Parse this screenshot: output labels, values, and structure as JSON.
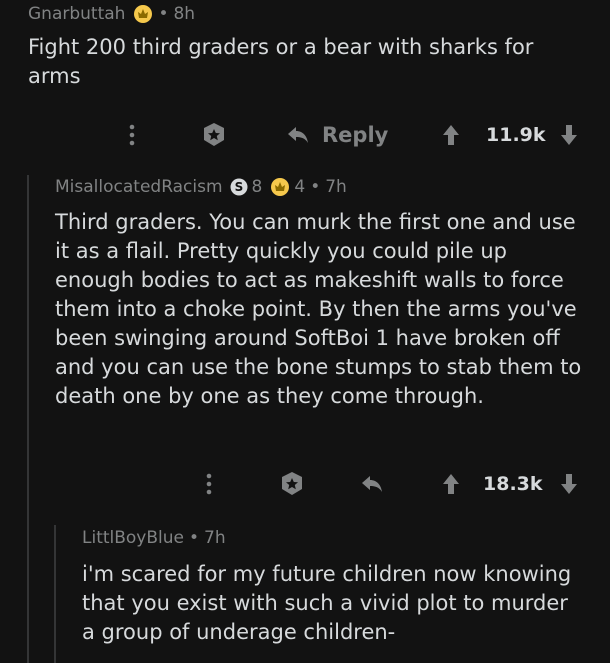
{
  "comments": [
    {
      "username": "Gnarbuttah",
      "time": "8h",
      "text": "Fight 200 third graders or a bear with sharks for arms",
      "reply_label": "Reply",
      "score": "11.9k"
    },
    {
      "username": "MisallocatedRacism",
      "coin_count": "8",
      "award_count": "4",
      "time": "7h",
      "text": "Third graders. You can murk the first one and use it as a flail. Pretty quickly you could pile up enough bodies to act as makeshift walls to force them into a choke point. By then the arms you've been swinging around SoftBoi 1 have broken off and you can use the bone stumps to stab them to death one by one as they come through.",
      "score": "18.3k"
    },
    {
      "username": "LittlBoyBlue",
      "time": "7h",
      "text": "i'm scared for my future children now knowing that you exist with such a vivid plot to murder a group of underage children-"
    }
  ],
  "colors": {
    "background": "#121212",
    "text": "#d7dadc",
    "muted": "#818384",
    "award_gold": "#f5c84c"
  }
}
